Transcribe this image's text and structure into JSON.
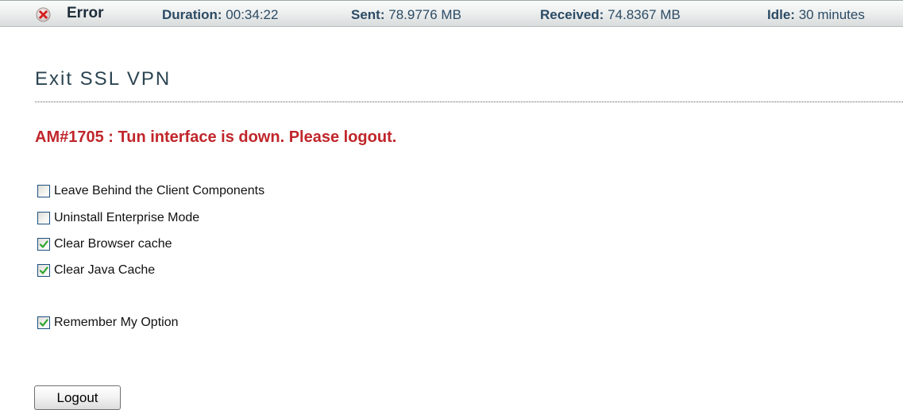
{
  "status_bar": {
    "status_icon": "error-x-icon",
    "status_label": "Error",
    "duration_label": "Duration:",
    "duration_value": "00:34:22",
    "sent_label": "Sent:",
    "sent_value": "78.9776 MB",
    "received_label": "Received:",
    "received_value": "74.8367 MB",
    "idle_label": "Idle:",
    "idle_value": "30 minutes"
  },
  "page": {
    "title": "Exit SSL VPN",
    "error_message": "AM#1705 : Tun interface is down. Please logout."
  },
  "options": [
    {
      "label": "Leave Behind the Client Components",
      "checked": false
    },
    {
      "label": "Uninstall Enterprise Mode",
      "checked": false
    },
    {
      "label": "Clear Browser cache",
      "checked": true
    },
    {
      "label": "Clear Java Cache",
      "checked": true
    }
  ],
  "remember": {
    "label": "Remember My Option",
    "checked": true
  },
  "logout_button": {
    "label": "Logout"
  },
  "colors": {
    "error_text": "#c0262b",
    "status_text": "#2c4b64",
    "check_mark": "#2aa52a",
    "checkbox_border": "#1c5180"
  }
}
